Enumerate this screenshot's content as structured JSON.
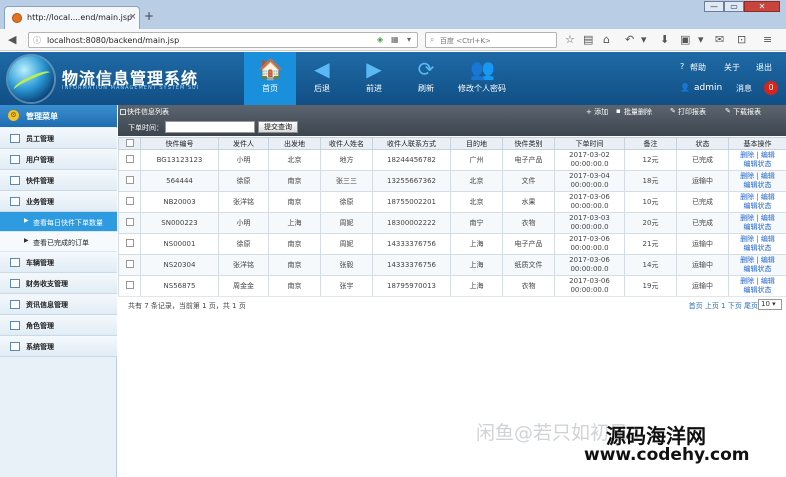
{
  "browser": {
    "tab_title": "http://local....end/main.jsp",
    "tab_close": "×",
    "new_tab": "+",
    "url": "localhost:8080/backend/main.jsp",
    "search_placeholder": "百度 <Ctrl+K>",
    "window_minimize": "—",
    "window_restore": "▭",
    "window_close": "✕"
  },
  "header": {
    "title": "物流信息管理系统",
    "subtitle": "INFORMATION MANAGEMENT SYSTEM SUI",
    "nav": [
      {
        "label": "首页",
        "icon": "home-icon"
      },
      {
        "label": "后退",
        "icon": "back-arrow-icon"
      },
      {
        "label": "前进",
        "icon": "forward-arrow-icon"
      },
      {
        "label": "刷新",
        "icon": "refresh-icon"
      },
      {
        "label": "修改个人密码",
        "icon": "users-icon"
      }
    ],
    "help": "帮助",
    "about": "关于",
    "logout": "退出",
    "username": "admin",
    "messages": "消息",
    "message_count": "0"
  },
  "sidebar": {
    "title": "管理菜单",
    "items": [
      {
        "label": "员工管理"
      },
      {
        "label": "用户管理"
      },
      {
        "label": "快件管理"
      },
      {
        "label": "业务管理"
      }
    ],
    "subitems": [
      {
        "label": "查看每日快件下单数量"
      },
      {
        "label": "查看已完成的订单"
      }
    ],
    "items2": [
      {
        "label": "车辆管理"
      },
      {
        "label": "财务收支管理"
      },
      {
        "label": "资讯信息管理"
      },
      {
        "label": "角色管理"
      },
      {
        "label": "系统管理"
      }
    ]
  },
  "toolbar": {
    "title": "快件信息列表",
    "add": "+ 添加",
    "batch_delete": "批量删除",
    "print": "打印报表",
    "download": "下载报表",
    "query_label": "下单时间：",
    "query_button": "提交查询"
  },
  "table": {
    "headers": [
      "快件编号",
      "发件人",
      "出发地",
      "收件人姓名",
      "收件人联系方式",
      "目的地",
      "快件类别",
      "下单时间",
      "备注",
      "状态",
      "基本操作"
    ],
    "rows": [
      [
        "BG13123123",
        "小明",
        "北京",
        "地方",
        "18244456782",
        "广州",
        "电子产品",
        "2017-03-02",
        "00:00:00.0",
        "12元",
        "已完成"
      ],
      [
        "564444",
        "徐原",
        "南京",
        "张三三",
        "13255667362",
        "北京",
        "文件",
        "2017-03-04",
        "00:00:00.0",
        "18元",
        "运输中"
      ],
      [
        "NB20003",
        "张洋铭",
        "南京",
        "徐原",
        "18755002201",
        "北京",
        "水果",
        "2017-03-06",
        "00:00:00.0",
        "10元",
        "已完成"
      ],
      [
        "SN000223",
        "小明",
        "上海",
        "周妮",
        "18300002222",
        "南宁",
        "衣物",
        "2017-03-03",
        "00:00:00.0",
        "20元",
        "已完成"
      ],
      [
        "NS00001",
        "徐原",
        "南京",
        "周妮",
        "14333376756",
        "上海",
        "电子产品",
        "2017-03-06",
        "00:00:00.0",
        "21元",
        "运输中"
      ],
      [
        "NS20304",
        "张洋铭",
        "南京",
        "张毅",
        "14333376756",
        "上海",
        "纸质文件",
        "2017-03-06",
        "00:00:00.0",
        "14元",
        "运输中"
      ],
      [
        "NS56875",
        "周金金",
        "南京",
        "张宇",
        "18795970013",
        "上海",
        "衣物",
        "2017-03-06",
        "00:00:00.0",
        "19元",
        "运输中"
      ]
    ],
    "op_delete": "删除",
    "op_sep": "|",
    "op_edit": "编辑",
    "op_edit_state": "编辑状态"
  },
  "pager": {
    "summary": "共有 7 条记录，当前第 1 页，共 1 页",
    "links": "首页 上页 1 下页 尾页",
    "page_size": "10"
  },
  "watermark": {
    "line1": "闲鱼@若只如初见a",
    "line2": "源码海洋网",
    "line3": "www.codehy.com"
  }
}
